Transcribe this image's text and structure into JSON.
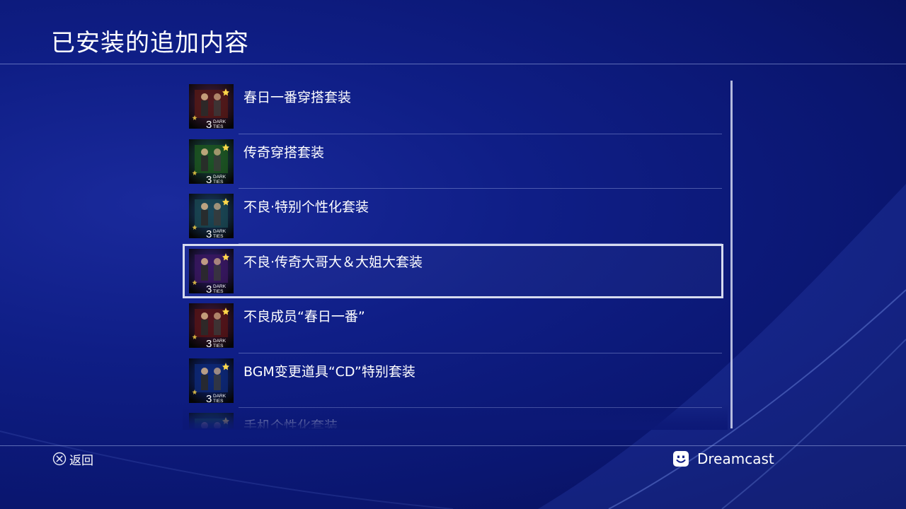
{
  "header": {
    "title": "已安装的追加内容"
  },
  "items": [
    {
      "label": "春日一番穿搭套装",
      "thumb_icon": "outfit-thumbnail",
      "thumb_color": "#5a1a14"
    },
    {
      "label": "传奇穿搭套装",
      "thumb_icon": "outfit-thumbnail",
      "thumb_color": "#1d5a1e"
    },
    {
      "label": "不良·特别个性化套装",
      "thumb_icon": "customization-thumbnail",
      "thumb_color": "#1b4a52"
    },
    {
      "label": "不良·传奇大哥大＆大姐大套装",
      "thumb_icon": "gang-leaders-thumbnail",
      "thumb_color": "#3b1760",
      "selected": true
    },
    {
      "label": "不良成员“春日一番”",
      "thumb_icon": "member-thumbnail",
      "thumb_color": "#5a1414"
    },
    {
      "label": "BGM变更道具“CD”特别套装",
      "thumb_icon": "cd-box-thumbnail",
      "thumb_color": "#0d2a78"
    },
    {
      "label": "手机个性化套装",
      "thumb_icon": "phone-thumbnail",
      "thumb_color": "#1d5a3a"
    }
  ],
  "thumb_badge": {
    "number": "3",
    "line1": "DARK",
    "line2": "TIES"
  },
  "footer": {
    "back_label": "返回",
    "back_icon": "cross-button-icon",
    "user_name": "Dreamcast",
    "user_icon": "smiley-avatar-icon"
  },
  "colors": {
    "background": "#0f1e86",
    "selection_outline": "#d6dbef",
    "text": "#ffffff"
  }
}
